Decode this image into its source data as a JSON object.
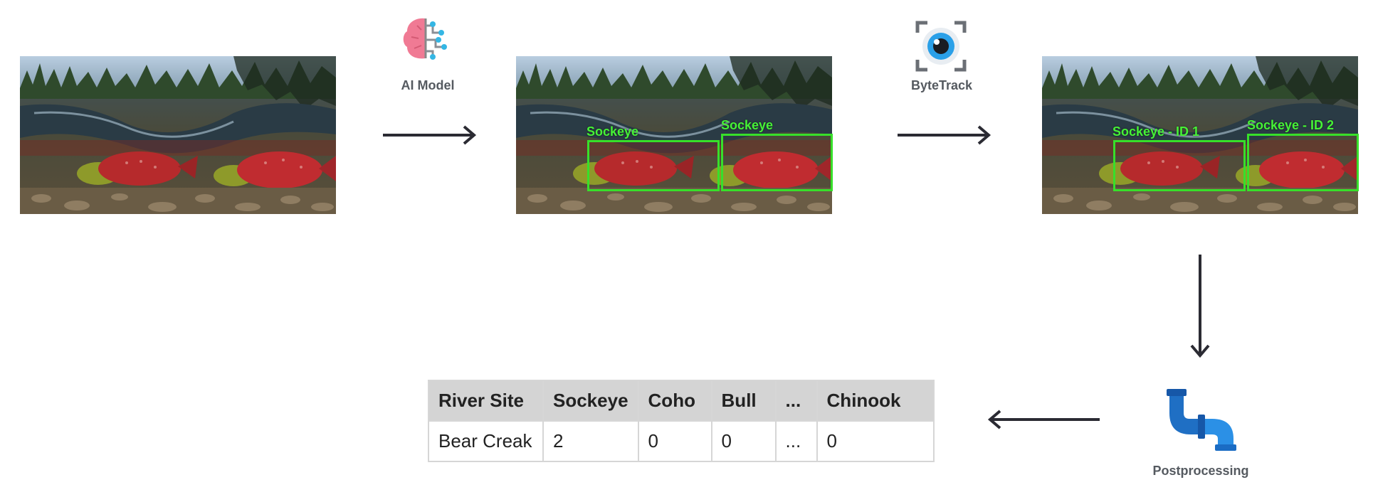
{
  "stages": {
    "model_label": "AI Model",
    "tracker_label": "ByteTrack",
    "post_label": "Postprocessing"
  },
  "detections": [
    {
      "label": "Sockeye"
    },
    {
      "label": "Sockeye"
    }
  ],
  "tracks": [
    {
      "label": "Sockeye - ID 1"
    },
    {
      "label": "Sockeye - ID 2"
    }
  ],
  "table": {
    "headers": [
      "River Site",
      "Sockeye",
      "Coho",
      "Bull",
      "...",
      "Chinook"
    ],
    "rows": [
      [
        "Bear Creak",
        "2",
        "0",
        "0",
        "...",
        "0"
      ]
    ]
  },
  "icons": {
    "model": "brain-circuit-icon",
    "tracker": "eye-icon",
    "post": "pipe-icon"
  },
  "colors": {
    "box": "#37e02a",
    "arrow": "#2b2b33",
    "pipe": "#1f7ed8"
  }
}
